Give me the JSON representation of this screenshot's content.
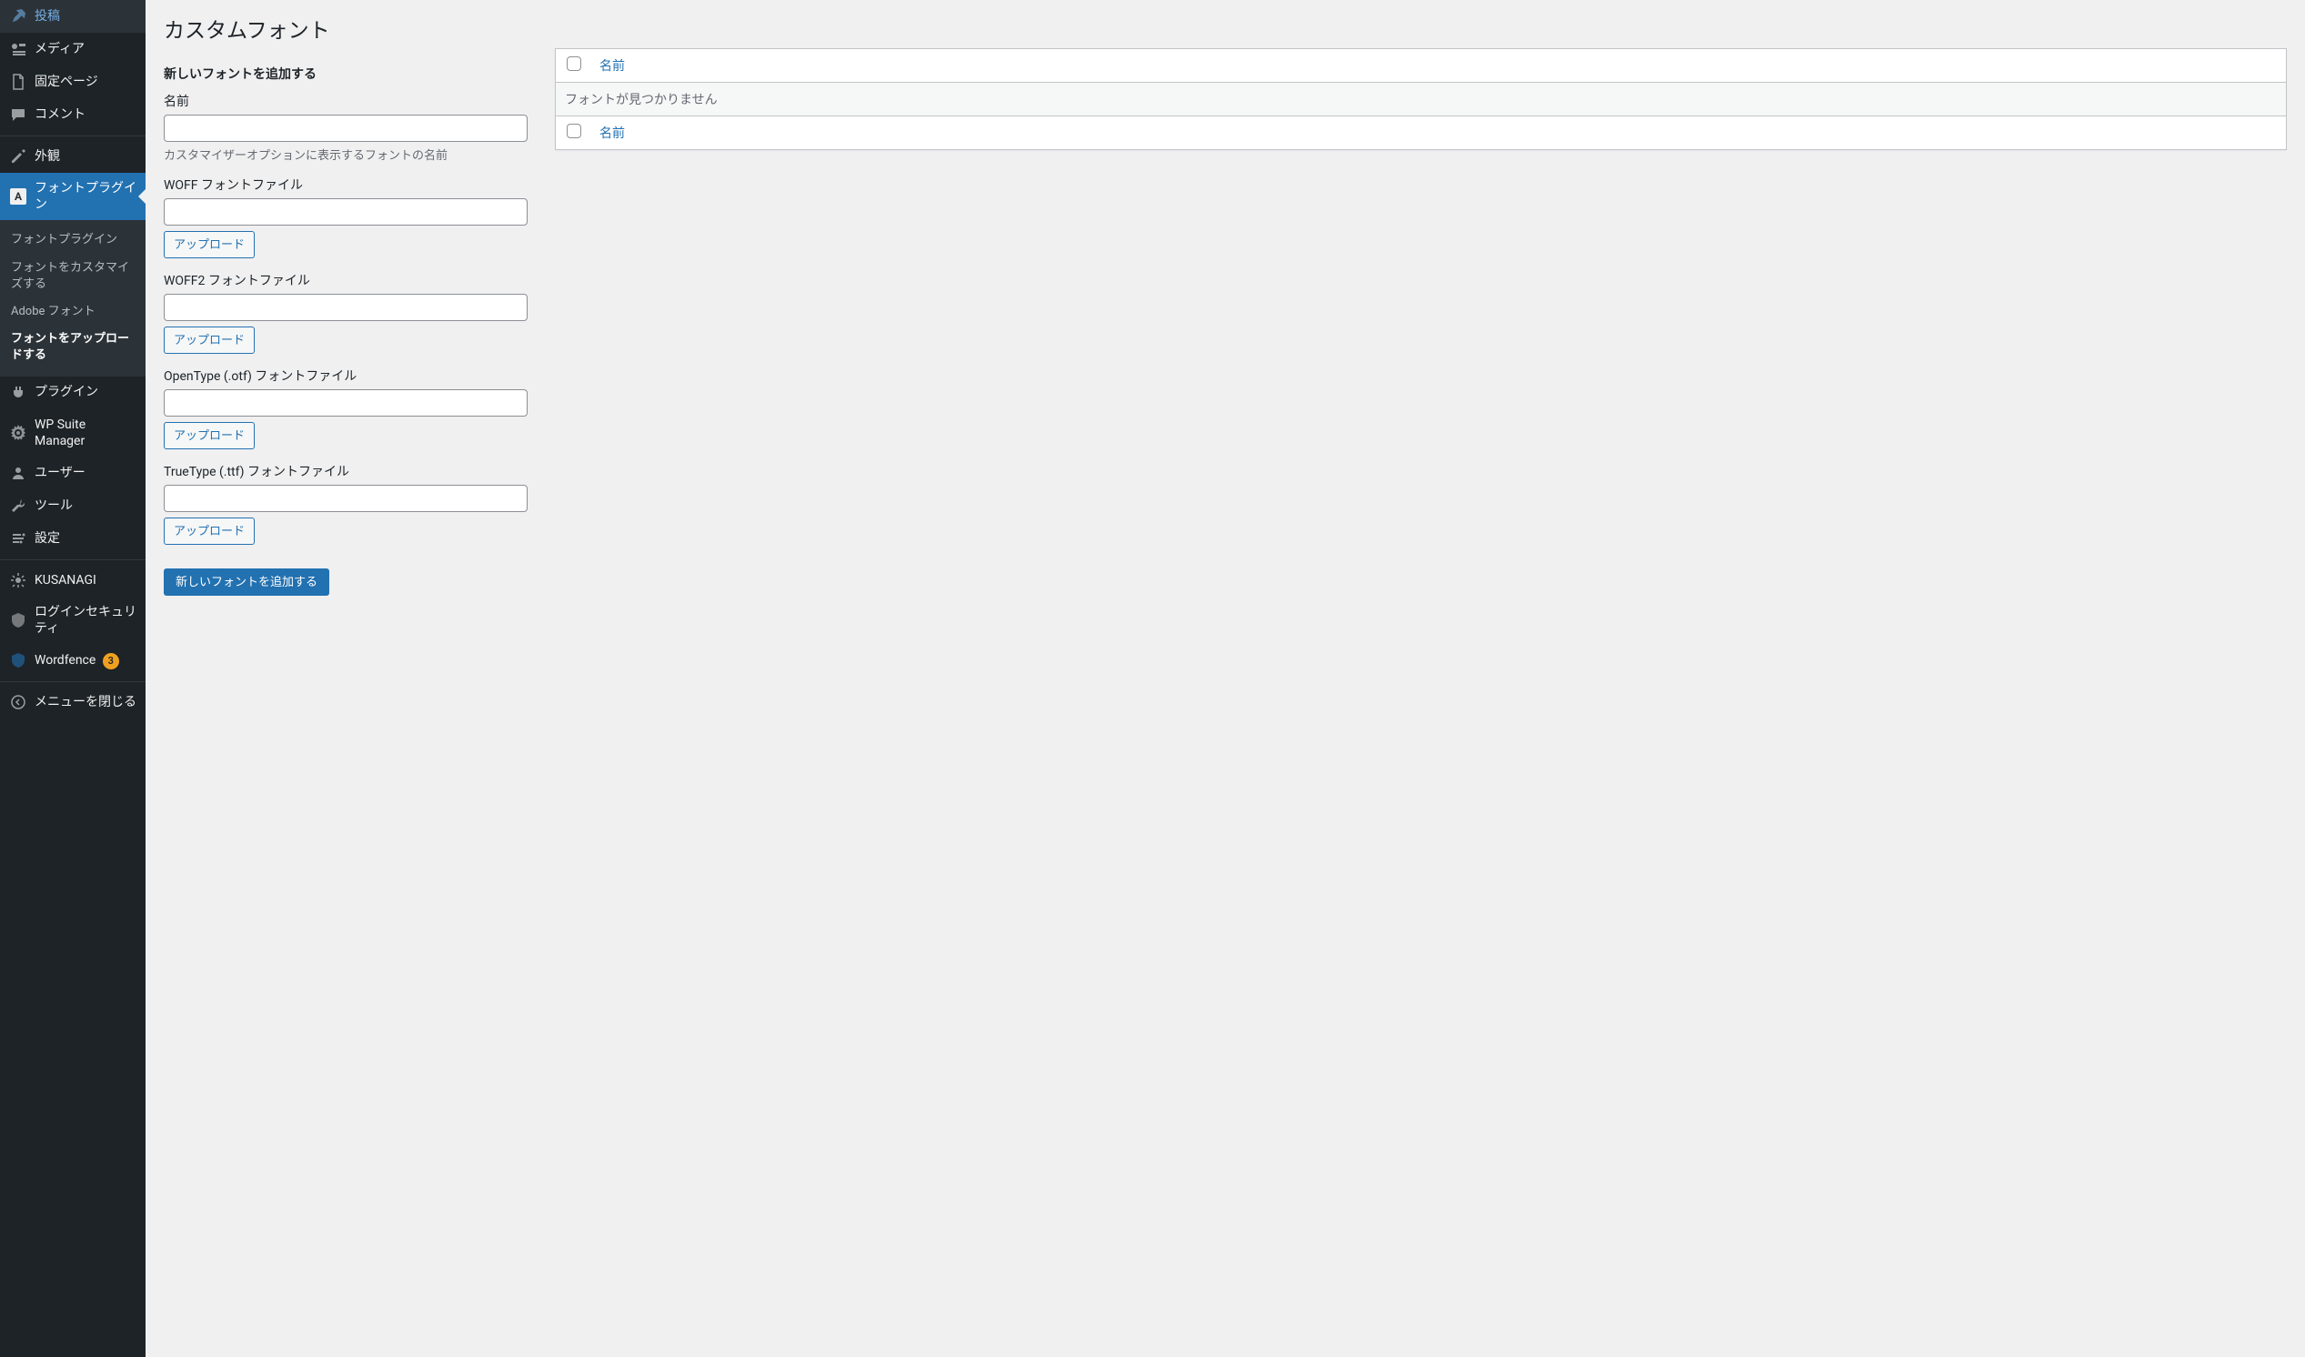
{
  "sidebar": {
    "posts": "投稿",
    "media": "メディア",
    "pages": "固定ページ",
    "comments": "コメント",
    "appearance": "外観",
    "font_plugin": "フォントプラグイン",
    "sub_font_plugin": "フォントプラグイン",
    "sub_customize": "フォントをカスタマイズする",
    "sub_adobe": "Adobe フォント",
    "sub_upload": "フォントをアップロードする",
    "plugins": "プラグイン",
    "wp_suite": "WP Suite Manager",
    "users": "ユーザー",
    "tools": "ツール",
    "settings": "設定",
    "kusanagi": "KUSANAGI",
    "login_security": "ログインセキュリティ",
    "wordfence": "Wordfence",
    "wordfence_badge": "3",
    "collapse": "メニューを閉じる"
  },
  "page": {
    "title": "カスタムフォント",
    "subtitle": "新しいフォントを追加する"
  },
  "form": {
    "name_label": "名前",
    "name_help": "カスタマイザーオプションに表示するフォントの名前",
    "woff_label": "WOFF フォントファイル",
    "woff2_label": "WOFF2 フォントファイル",
    "otf_label": "OpenType (.otf) フォントファイル",
    "ttf_label": "TrueType (.ttf) フォントファイル",
    "upload_btn": "アップロード",
    "submit": "新しいフォントを追加する"
  },
  "table": {
    "header_name": "名前",
    "empty": "フォントが見つかりません",
    "footer_name": "名前"
  }
}
